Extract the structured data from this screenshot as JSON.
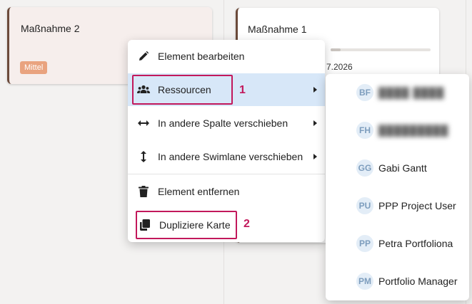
{
  "cards": {
    "left": {
      "title": "Maßnahme 2",
      "badge": "Mittel"
    },
    "right": {
      "title": "Maßnahme 1",
      "date_fragment": "7.2026",
      "progress": 0.1
    }
  },
  "context_menu": {
    "items": [
      {
        "label": "Element bearbeiten",
        "icon": "pencil-icon"
      },
      {
        "label": "Ressourcen",
        "icon": "users-icon",
        "submenu": true,
        "active": true
      },
      {
        "label": "In andere Spalte verschieben",
        "icon": "horizontal-arrows-icon",
        "submenu": true
      },
      {
        "label": "In andere Swimlane verschieben",
        "icon": "vertical-arrows-icon",
        "submenu": true
      },
      {
        "label": "Element entfernen",
        "icon": "trash-icon"
      },
      {
        "label": "Dupliziere Karte",
        "icon": "copy-icon"
      }
    ]
  },
  "annotations": {
    "one": "1",
    "two": "2"
  },
  "resources_submenu": {
    "items": [
      {
        "initials": "BF",
        "name": "████ ████",
        "redacted": true
      },
      {
        "initials": "FH",
        "name": "█████████",
        "redacted": true
      },
      {
        "initials": "GG",
        "name": "Gabi Gantt"
      },
      {
        "initials": "PU",
        "name": "PPP Project User"
      },
      {
        "initials": "PP",
        "name": "Petra Portfoliona"
      },
      {
        "initials": "PM",
        "name": "Portfolio Manager"
      }
    ]
  },
  "colors": {
    "highlight": "#c2185b",
    "active_item": "#d7e7f8",
    "badge": "#e9a37f",
    "avatar_bg": "#e3edf7",
    "avatar_text": "#7d9dbd"
  }
}
